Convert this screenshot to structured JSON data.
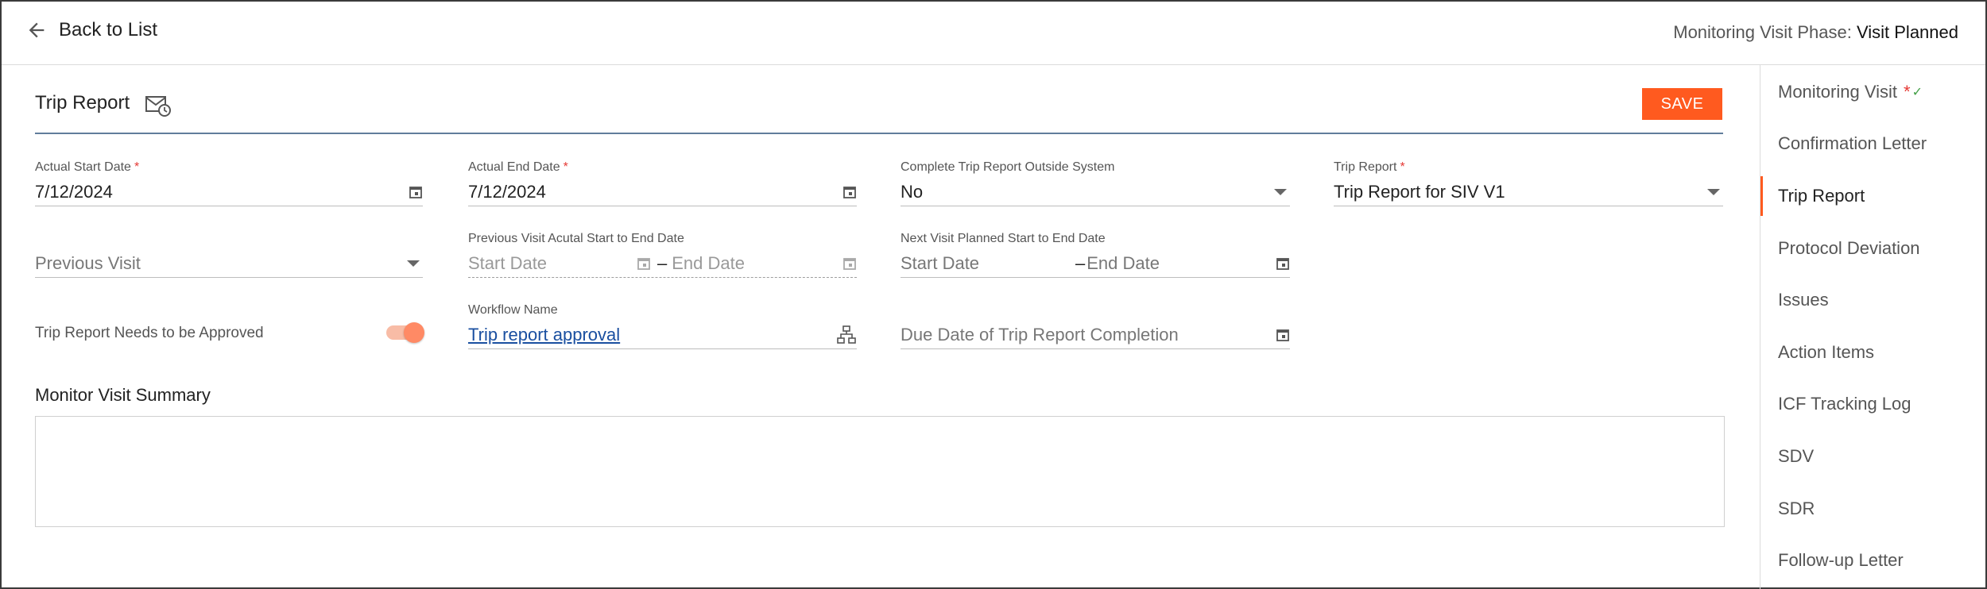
{
  "header": {
    "back_label": "Back to List",
    "phase_label": "Monitoring Visit Phase:",
    "phase_value": "Visit Planned"
  },
  "section": {
    "title": "Trip Report",
    "save_label": "SAVE"
  },
  "fields": {
    "actual_start": {
      "label": "Actual Start Date",
      "required_mark": "*",
      "value": "7/12/2024"
    },
    "actual_end": {
      "label": "Actual End Date",
      "required_mark": "*",
      "value": "7/12/2024"
    },
    "complete_outside": {
      "label": "Complete Trip Report Outside System",
      "value": "No"
    },
    "trip_report": {
      "label": "Trip Report",
      "required_mark": "*",
      "value": "Trip Report for SIV V1"
    },
    "previous_visit": {
      "placeholder": "Previous Visit"
    },
    "prev_range": {
      "label": "Previous Visit Acutal Start to End Date",
      "start_placeholder": "Start Date",
      "dash": "–",
      "end_placeholder": "End Date"
    },
    "next_range": {
      "label": "Next Visit Planned Start to End Date",
      "start_placeholder": "Start Date",
      "dash": "–",
      "end_placeholder": "End Date"
    },
    "needs_approval": {
      "label": "Trip Report Needs to be Approved",
      "checked": true
    },
    "workflow": {
      "label": "Workflow Name",
      "value": "Trip report approval"
    },
    "due_date": {
      "placeholder": "Due Date of Trip Report Completion"
    },
    "summary": {
      "label": "Monitor Visit Summary",
      "value": ""
    }
  },
  "sidenav": {
    "items": [
      {
        "label": "Monitoring Visit",
        "star": "*",
        "check": "✓",
        "active": false
      },
      {
        "label": "Confirmation Letter",
        "active": false
      },
      {
        "label": "Trip Report",
        "active": true
      },
      {
        "label": "Protocol Deviation",
        "active": false
      },
      {
        "label": "Issues",
        "active": false
      },
      {
        "label": "Action Items",
        "active": false
      },
      {
        "label": "ICF Tracking Log",
        "active": false
      },
      {
        "label": "SDV",
        "active": false
      },
      {
        "label": "SDR",
        "active": false
      },
      {
        "label": "Follow-up Letter",
        "active": false
      }
    ]
  },
  "colors": {
    "accent": "#ff5a1f",
    "link": "#1a4fa0",
    "required": "#e53935",
    "toggle_knob": "#ff8a65",
    "toggle_track": "#f8bca6"
  },
  "icons": [
    "arrow-left-icon",
    "mail-clock-icon",
    "calendar-icon",
    "dropdown-caret-icon",
    "workflow-hierarchy-icon"
  ]
}
